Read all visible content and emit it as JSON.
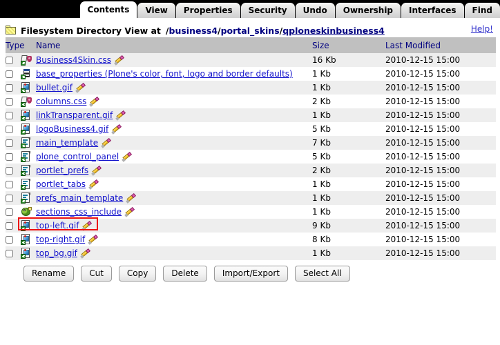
{
  "tabs": [
    {
      "label": "Contents",
      "active": true
    },
    {
      "label": "View",
      "active": false
    },
    {
      "label": "Properties",
      "active": false
    },
    {
      "label": "Security",
      "active": false
    },
    {
      "label": "Undo",
      "active": false
    },
    {
      "label": "Ownership",
      "active": false
    },
    {
      "label": "Interfaces",
      "active": false
    },
    {
      "label": "Find",
      "active": false
    }
  ],
  "header": {
    "folder_icon": "folder-icon",
    "title": "Filesystem Directory View at",
    "path_segments": [
      "business4",
      "portal_skins",
      "qploneskinbusiness4"
    ],
    "path_display": "/business4/portal_skins/qploneskinbusiness4",
    "help_label": "Help!"
  },
  "table": {
    "columns": [
      "Type",
      "Name",
      "Size",
      "Last Modified"
    ],
    "rows": [
      {
        "icon": "css-file-icon",
        "name": "Business4Skin.css",
        "size": "16 Kb",
        "modified": "2010-12-15 15:00",
        "editable": true,
        "wrap": false,
        "highlighted": false
      },
      {
        "icon": "properties-file-icon",
        "name": "base_properties (Plone's color, font, logo and border defaults)",
        "size": "1 Kb",
        "modified": "2010-12-15 15:00",
        "editable": false,
        "wrap": true,
        "highlighted": false
      },
      {
        "icon": "image-file-icon",
        "name": "bullet.gif",
        "size": "1 Kb",
        "modified": "2010-12-15 15:00",
        "editable": true,
        "wrap": false,
        "highlighted": false
      },
      {
        "icon": "css-file-icon",
        "name": "columns.css",
        "size": "2 Kb",
        "modified": "2010-12-15 15:00",
        "editable": true,
        "wrap": false,
        "highlighted": false
      },
      {
        "icon": "image-file-icon",
        "name": "linkTransparent.gif",
        "size": "1 Kb",
        "modified": "2010-12-15 15:00",
        "editable": true,
        "wrap": false,
        "highlighted": false
      },
      {
        "icon": "image-file-icon",
        "name": "logoBusiness4.gif",
        "size": "5 Kb",
        "modified": "2010-12-15 15:00",
        "editable": true,
        "wrap": false,
        "highlighted": false
      },
      {
        "icon": "template-file-icon",
        "name": "main_template",
        "size": "7 Kb",
        "modified": "2010-12-15 15:00",
        "editable": true,
        "wrap": false,
        "highlighted": false
      },
      {
        "icon": "template-file-icon",
        "name": "plone_control_panel",
        "size": "5 Kb",
        "modified": "2010-12-15 15:00",
        "editable": true,
        "wrap": false,
        "highlighted": false
      },
      {
        "icon": "template-file-icon",
        "name": "portlet_prefs",
        "size": "2 Kb",
        "modified": "2010-12-15 15:00",
        "editable": true,
        "wrap": false,
        "highlighted": false
      },
      {
        "icon": "template-file-icon",
        "name": "portlet_tabs",
        "size": "1 Kb",
        "modified": "2010-12-15 15:00",
        "editable": true,
        "wrap": false,
        "highlighted": false
      },
      {
        "icon": "template-file-icon",
        "name": "prefs_main_template",
        "size": "1 Kb",
        "modified": "2010-12-15 15:00",
        "editable": true,
        "wrap": false,
        "highlighted": false
      },
      {
        "icon": "script-file-icon",
        "name": "sections_css_include",
        "size": "1 Kb",
        "modified": "2010-12-15 15:00",
        "editable": true,
        "wrap": false,
        "highlighted": false
      },
      {
        "icon": "image-file-icon",
        "name": "top-left.gif",
        "size": "9 Kb",
        "modified": "2010-12-15 15:00",
        "editable": true,
        "wrap": false,
        "highlighted": true
      },
      {
        "icon": "image-file-icon",
        "name": "top-right.gif",
        "size": "8 Kb",
        "modified": "2010-12-15 15:00",
        "editable": true,
        "wrap": false,
        "highlighted": false
      },
      {
        "icon": "image-file-icon",
        "name": "top_bg.gif",
        "size": "1 Kb",
        "modified": "2010-12-15 15:00",
        "editable": true,
        "wrap": false,
        "highlighted": false
      }
    ]
  },
  "buttons": [
    {
      "label": "Rename"
    },
    {
      "label": "Cut"
    },
    {
      "label": "Copy"
    },
    {
      "label": "Delete"
    },
    {
      "label": "Import/Export"
    },
    {
      "label": "Select All"
    }
  ],
  "colors": {
    "tabbar_background": "#000000",
    "active_tab": "#ffffff",
    "inactive_tab": "#dedede",
    "header_row": "#c0c0c0",
    "row_odd": "#eeeeee",
    "row_even": "#ffffff",
    "link": "#1111cc",
    "path": "#000080",
    "highlight_border": "#ee1111"
  }
}
